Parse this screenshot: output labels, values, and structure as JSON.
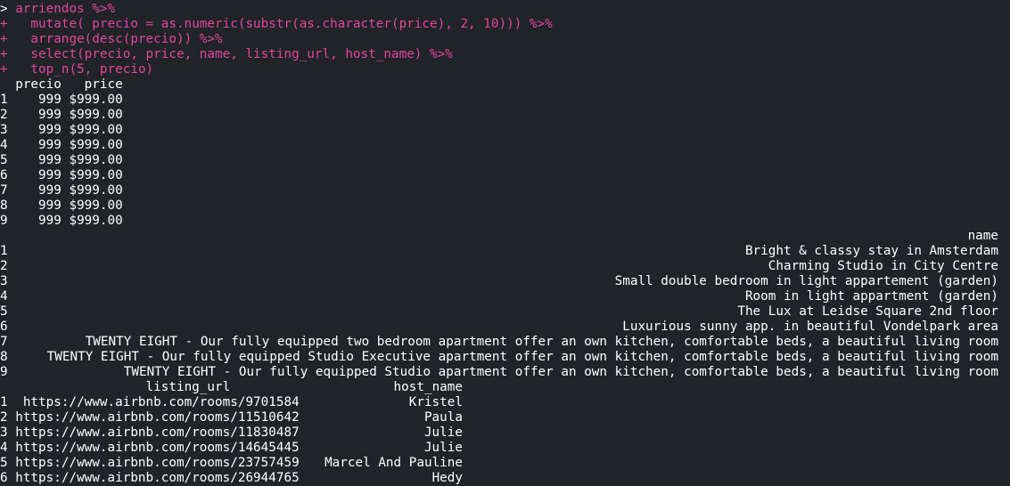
{
  "console": {
    "command": {
      "line1_prompt": ">",
      "line1": "arriendos %>%",
      "cont_prompt": "+",
      "line2": "  mutate( precio = as.numeric(substr(as.character(price), 2, 10))) %>%",
      "line3": "  arrange(desc(precio)) %>%",
      "line4": "  select(precio, price, name, listing_url, host_name) %>%",
      "line5": "  top_n(5, precio)"
    },
    "table1": {
      "header": "  precio   price",
      "rows": [
        "1    999 $999.00",
        "2    999 $999.00",
        "3    999 $999.00",
        "4    999 $999.00",
        "5    999 $999.00",
        "6    999 $999.00",
        "7    999 $999.00",
        "8    999 $999.00",
        "9    999 $999.00"
      ]
    },
    "table2": {
      "header": "name",
      "rows": [
        {
          "idx": "1",
          "name": "Bright & classy stay in Amsterdam"
        },
        {
          "idx": "2",
          "name": "Charming Studio in City Centre"
        },
        {
          "idx": "3",
          "name": "Small double bedroom in light appartement (garden)"
        },
        {
          "idx": "4",
          "name": "Room in light appartment (garden)"
        },
        {
          "idx": "5",
          "name": "The Lux at Leidse Square 2nd floor"
        },
        {
          "idx": "6",
          "name": "Luxurious sunny app. in beautiful Vondelpark area"
        },
        {
          "idx": "7",
          "name": "TWENTY EIGHT - Our fully equipped two bedroom apartment offer an own kitchen, comfortable beds, a beautiful living room"
        },
        {
          "idx": "8",
          "name": "TWENTY EIGHT - Our fully equipped Studio Executive apartment offer an own kitchen, comfortable beds, a beautiful living room"
        },
        {
          "idx": "9",
          "name": "TWENTY EIGHT - Our fully equipped Studio apartment offer an own kitchen, comfortable beds, a beautiful living room"
        }
      ]
    },
    "table3": {
      "header_url": "                   listing_url",
      "header_host": "host_name",
      "rows": [
        {
          "url": "1  https://www.airbnb.com/rooms/9701584",
          "host": "Kristel"
        },
        {
          "url": "2 https://www.airbnb.com/rooms/11510642",
          "host": "Paula"
        },
        {
          "url": "3 https://www.airbnb.com/rooms/11830487",
          "host": "Julie"
        },
        {
          "url": "4 https://www.airbnb.com/rooms/14645445",
          "host": "Julie"
        },
        {
          "url": "5 https://www.airbnb.com/rooms/23757459",
          "host": "Marcel And Pauline"
        },
        {
          "url": "6 https://www.airbnb.com/rooms/26944765",
          "host": "Hedy"
        }
      ]
    }
  },
  "colors": {
    "background": "#202328",
    "command_text": "#e1469a",
    "output_text": "#ffffff"
  }
}
